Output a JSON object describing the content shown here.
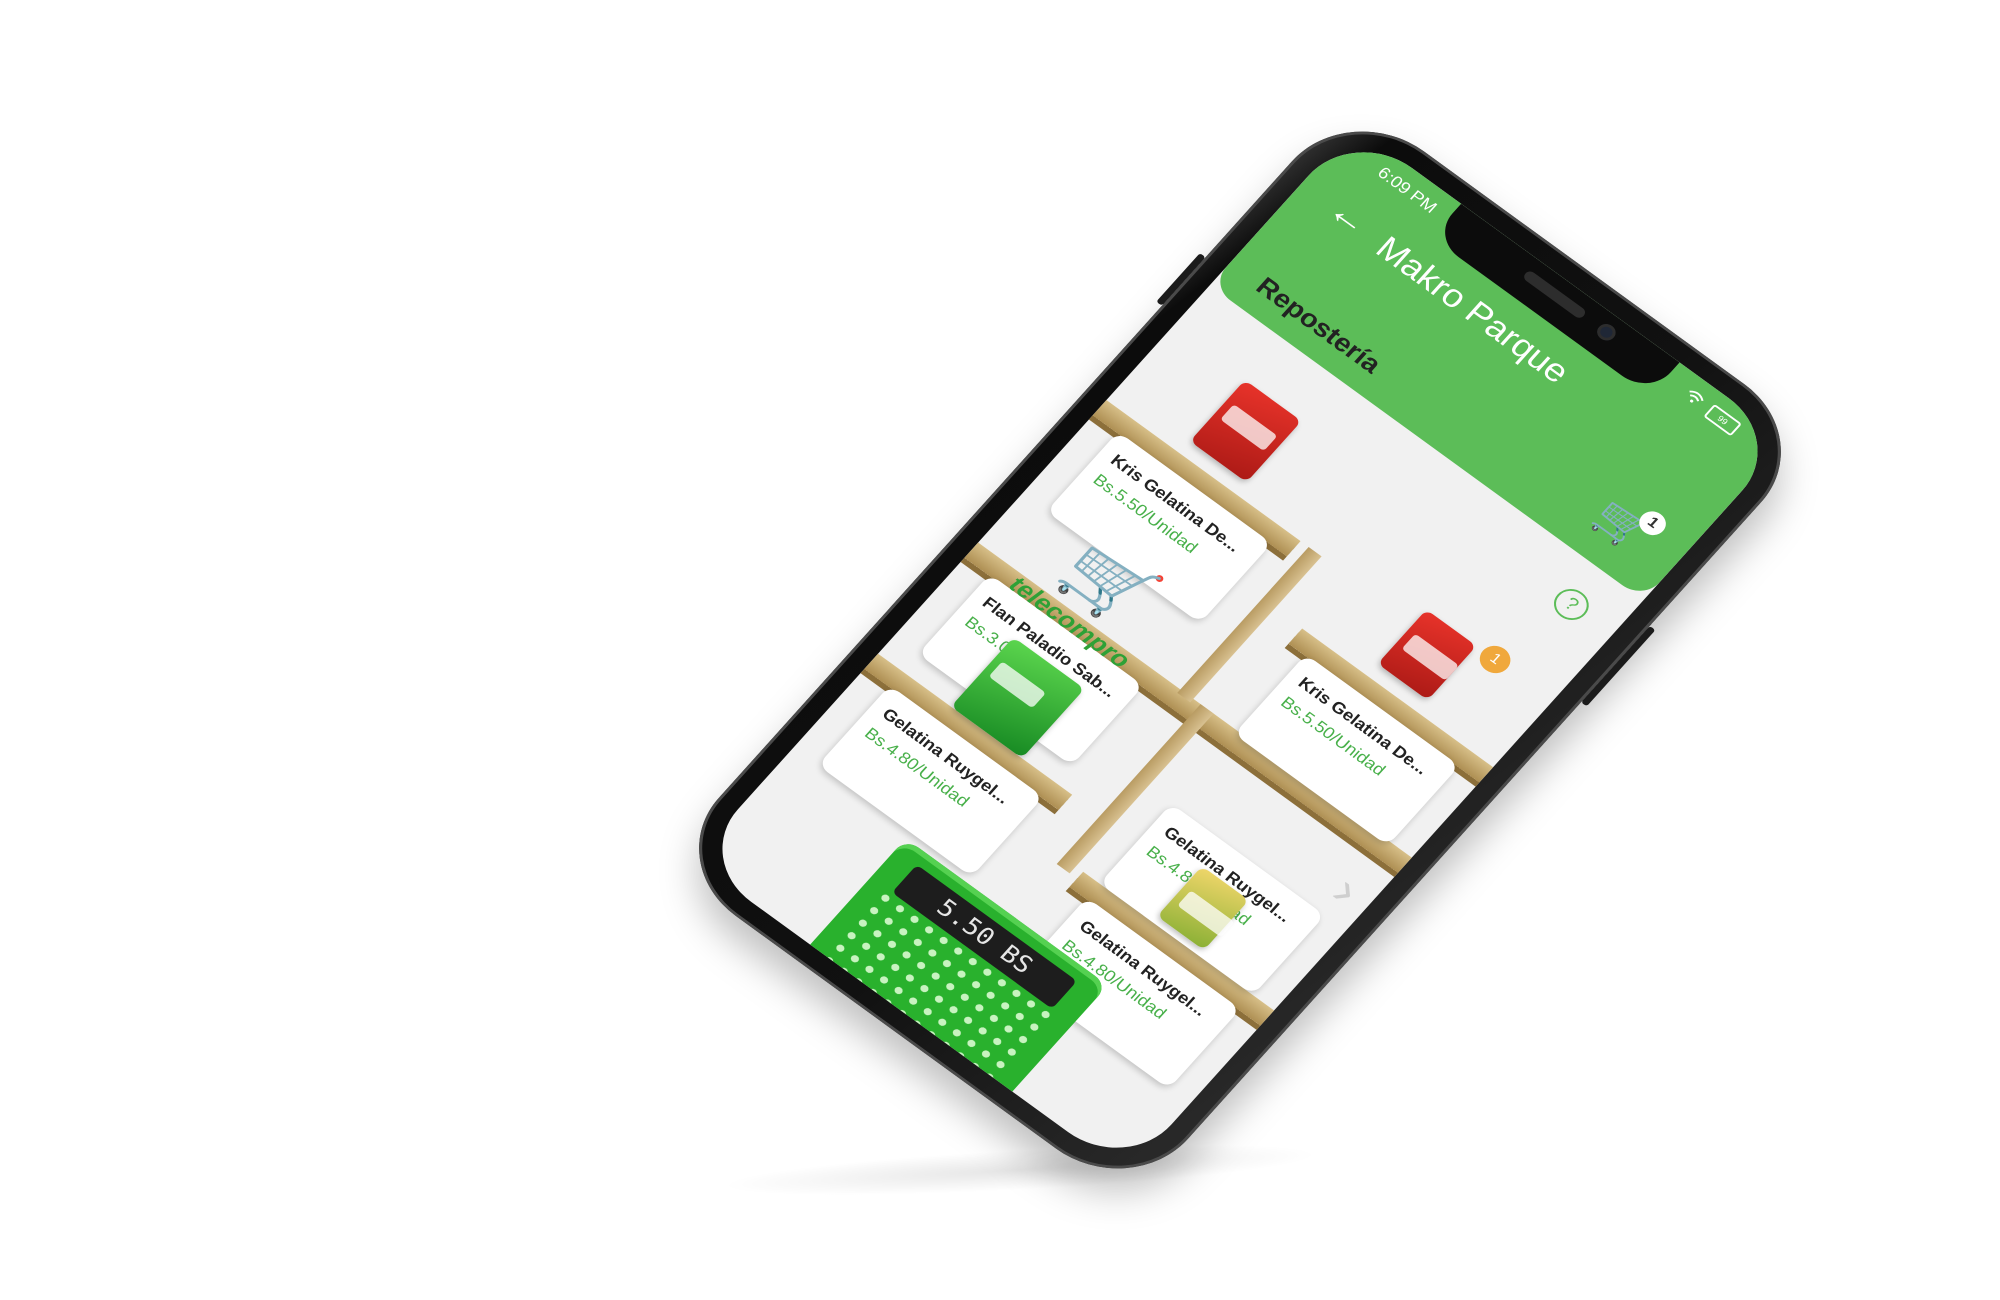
{
  "status_bar": {
    "time": "6:09 PM",
    "battery": "99"
  },
  "header": {
    "title": "Makro Parque",
    "back_icon": "arrow-left-icon",
    "cart_icon": "shopping-cart-icon",
    "cart_count": "1"
  },
  "section": {
    "title": "Repostería",
    "help_icon": "question-mark-icon",
    "help_glyph": "?"
  },
  "products": [
    {
      "name": "Kris Gelatina De...",
      "price": "Bs.5.50/Unidad",
      "pack_color": "red"
    },
    {
      "name": "Kris Gelatina De...",
      "price": "Bs.5.50/Unidad",
      "pack_color": "red",
      "qty": "1"
    },
    {
      "name": "Flan Paladio Sab...",
      "price": "Bs.3.00/Unidad",
      "pack_color": "none"
    },
    {
      "name": "Gelatina Ruygel...",
      "price": "Bs.4.80/Unidad",
      "pack_color": "none"
    },
    {
      "name": "Gelatina Ruygel...",
      "price": "Bs.4.80/Unidad",
      "pack_color": "green"
    },
    {
      "name": "Gelatina Ruygel...",
      "price": "Bs.4.80/Unidad",
      "pack_color": "yellow"
    }
  ],
  "brand": {
    "name": "telecompro",
    "icon": "shopping-cart-logo-icon"
  },
  "basket": {
    "total": "5.50 BS",
    "icon": "shopping-basket-icon"
  },
  "navigation": {
    "next_icon": "chevron-right-icon",
    "next_glyph": "›"
  },
  "colors": {
    "primary": "#5cbd58",
    "price": "#48b04a",
    "badge": "#f0a83c",
    "basket": "#29b12d"
  }
}
